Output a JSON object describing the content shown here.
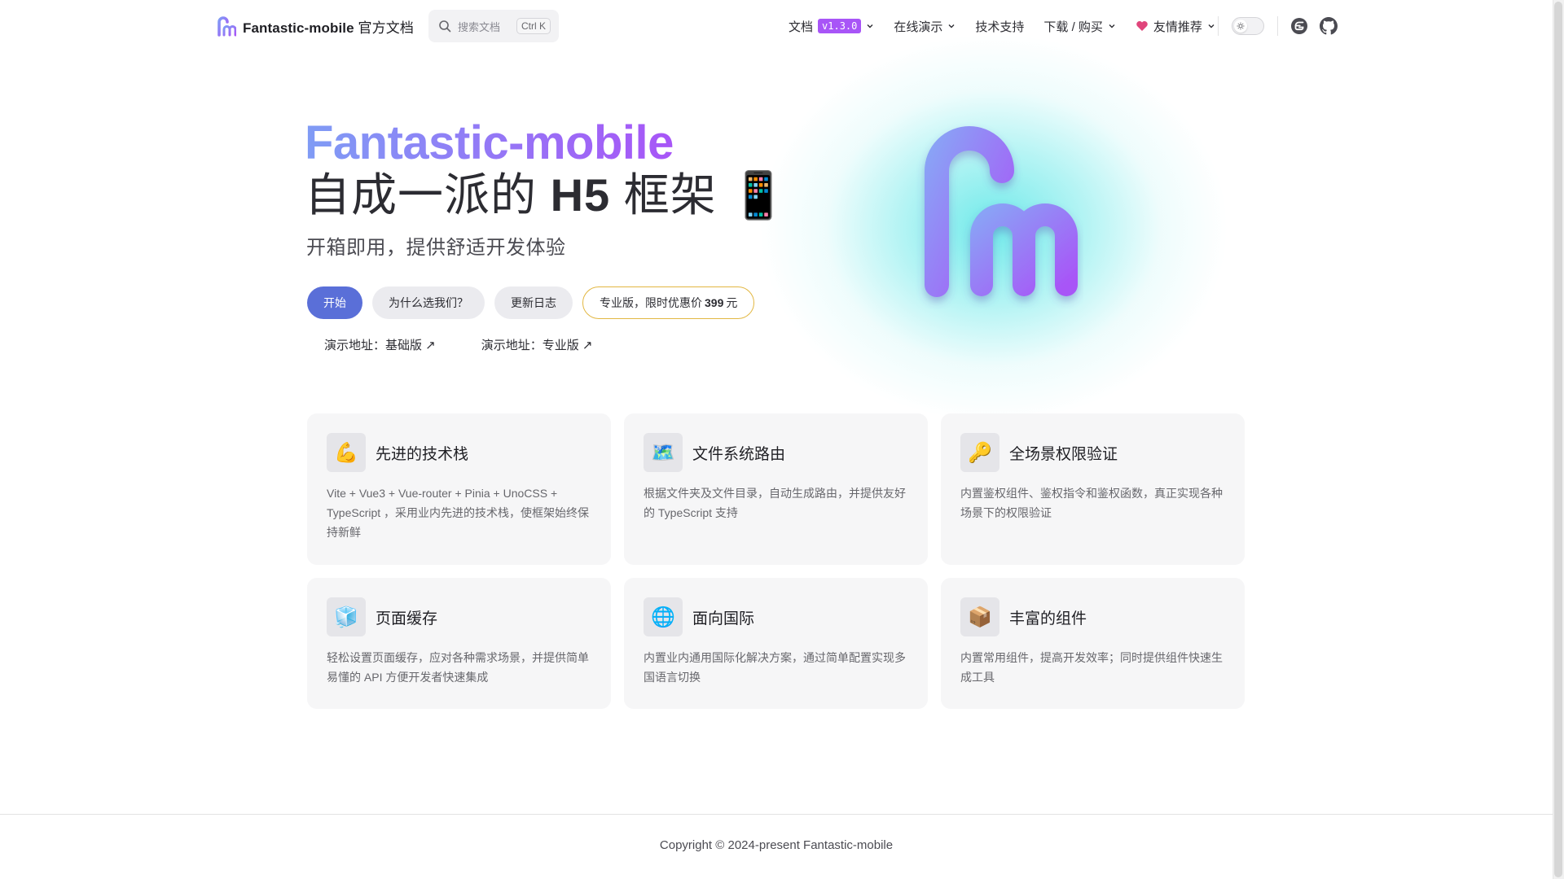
{
  "nav": {
    "brand": {
      "name": "Fantastic-mobile",
      "suffix": "官方文档"
    },
    "search": {
      "placeholder": "搜索文档",
      "shortcut": "Ctrl K"
    },
    "items": [
      {
        "label": "文档",
        "badge": "v1.3.0",
        "dropdown": true
      },
      {
        "label": "在线演示",
        "dropdown": true
      },
      {
        "label": "技术支持",
        "dropdown": false
      },
      {
        "label": "下载 / 购买",
        "dropdown": true
      },
      {
        "label": "友情推荐",
        "dropdown": true,
        "prefix_icon": "heart-icon"
      }
    ],
    "theme_toggle": {
      "state": "light"
    },
    "social": [
      "gitee-icon",
      "github-icon"
    ]
  },
  "hero": {
    "name": "Fantastic-mobile",
    "text_pre": "自成一派的 ",
    "text_strong": "H5",
    "text_post": " 框架 ",
    "text_emoji": "📱",
    "tagline": "开箱即用，提供舒适开发体验",
    "actions": {
      "start": "开始",
      "why": "为什么选我们？",
      "changelog": "更新日志",
      "pro_pre": "专业版，限时优惠价",
      "pro_price": "399",
      "pro_unit": "元"
    },
    "demos": {
      "basic": "演示地址：基础版 ↗",
      "pro": "演示地址：专业版 ↗"
    }
  },
  "features": [
    {
      "icon": "💪",
      "title": "先进的技术栈",
      "desc": "Vite + Vue3 + Vue-router + Pinia + UnoCSS + TypeScript ，采用业内先进的技术栈，使框架始终保持新鲜"
    },
    {
      "icon": "🗺️",
      "title": "文件系统路由",
      "desc": "根据文件夹及文件目录，自动生成路由，并提供友好的 TypeScript 支持"
    },
    {
      "icon": "🔑",
      "title": "全场景权限验证",
      "desc": "内置鉴权组件、鉴权指令和鉴权函数，真正实现各种场景下的权限验证"
    },
    {
      "icon": "🧊",
      "title": "页面缓存",
      "desc": "轻松设置页面缓存，应对各种需求场景，并提供简单易懂的 API 方便开发者快速集成"
    },
    {
      "icon": "🌐",
      "title": "面向国际",
      "desc": "内置业内通用国际化解决方案，通过简单配置实现多国语言切换"
    },
    {
      "icon": "📦",
      "title": "丰富的组件",
      "desc": "内置常用组件，提高开发效率；同时提供组件快速生成工具"
    }
  ],
  "footer": {
    "copyright": "Copyright © 2024-present Fantastic-mobile"
  },
  "colors": {
    "brand_gradient_start": "#7f9cf5",
    "brand_gradient_end": "#a855f7",
    "primary_button": "#5a6fd8",
    "pro_border": "#e2b742",
    "version_badge": "#a855f7"
  }
}
